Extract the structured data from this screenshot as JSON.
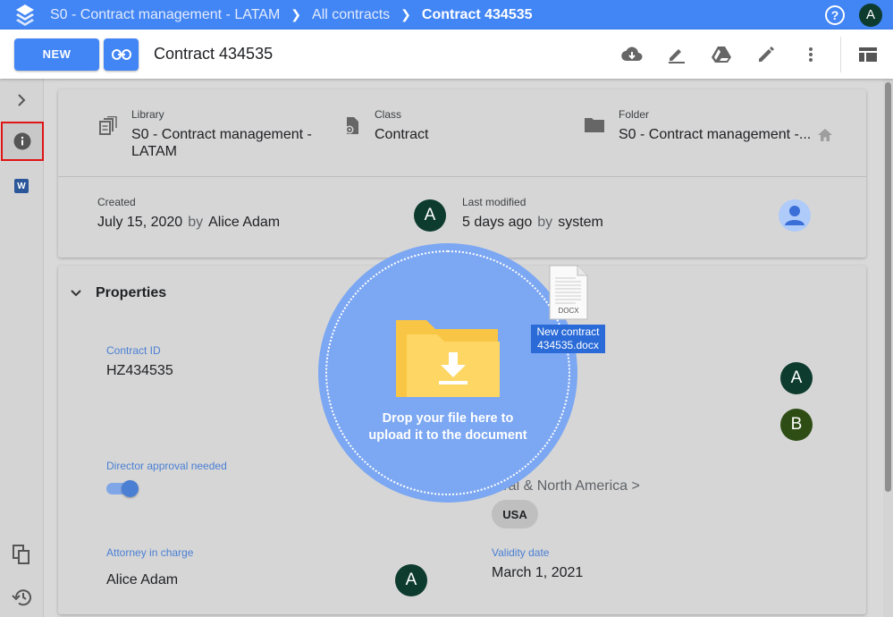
{
  "topbar": {
    "breadcrumbs": [
      "S0 - Contract management - LATAM",
      "All contracts",
      "Contract 434535"
    ],
    "user_initial": "A"
  },
  "toolbar": {
    "new_label": "NEW",
    "doc_title": "Contract 434535"
  },
  "info": {
    "library_label": "Library",
    "library_value": "S0 - Contract management - LATAM",
    "class_label": "Class",
    "class_value": "Contract",
    "folder_label": "Folder",
    "folder_value": "S0 - Contract management -...",
    "created_label": "Created",
    "created_date": "July 15, 2020",
    "created_by_word": "by",
    "created_by": "Alice Adam",
    "created_avatar": "A",
    "modified_label": "Last modified",
    "modified_date": "5 days ago",
    "modified_by_word": "by",
    "modified_by": "system"
  },
  "properties": {
    "title": "Properties",
    "contract_id_label": "Contract ID",
    "contract_id_value": "HZ434535",
    "avatar_a": "A",
    "avatar_b": "B",
    "director_label": "Director approval needed",
    "director_value": true,
    "region_path": "ntral & North America >",
    "region_chip": "USA",
    "attorney_label": "Attorney in charge",
    "attorney_value": "Alice Adam",
    "attorney_avatar": "A",
    "validity_label": "Validity date",
    "validity_value": "March 1, 2021"
  },
  "drop_zone": {
    "line1": "Drop your file here to",
    "line2": "upload it to the document"
  },
  "drag_file": {
    "type_label": "DOCX",
    "name_line1": "New contract",
    "name_line2": "434535.docx"
  },
  "colors": {
    "brand": "#4285f4",
    "avatar_green": "#0d3b2e",
    "avatar_olive": "#2e4d15",
    "field_label": "#4a7fd4",
    "drop_zone": "#7ca7f2",
    "selection_outline": "#e01414"
  }
}
